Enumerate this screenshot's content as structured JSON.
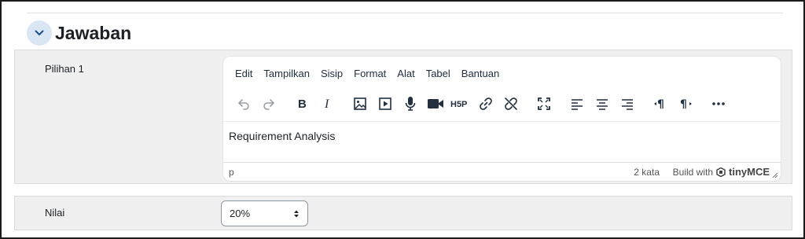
{
  "section": {
    "title": "Jawaban"
  },
  "choice": {
    "label": "Pilihan 1"
  },
  "editor": {
    "menu": [
      "Edit",
      "Tampilkan",
      "Sisip",
      "Format",
      "Alat",
      "Tabel",
      "Bantuan"
    ],
    "content": "Requirement Analysis",
    "path": "p",
    "word_count": "2 kata",
    "build_with": "Build with",
    "brand": "tinyMCE"
  },
  "grade": {
    "label": "Nilai",
    "value": "20%"
  }
}
